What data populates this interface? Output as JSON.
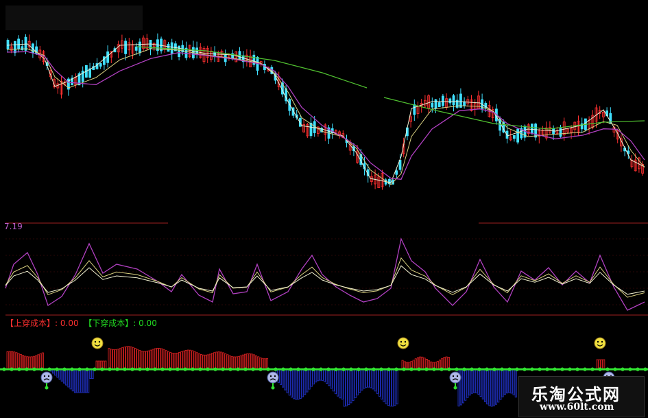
{
  "indicator": {
    "value_label": "7.19"
  },
  "legend": {
    "up_label": "【上穿成本】",
    "up_value": ": 0.00",
    "down_label": "【下穿成本】",
    "down_value": ": 0.00"
  },
  "watermark": {
    "site_name": "乐淘公式网",
    "site_url": "www.60lt.com"
  },
  "colors": {
    "background": "#000000",
    "up_candle": "#ff3030",
    "down_candle": "#40e0ff",
    "ma_white": "#f0f0d0",
    "ma_yellow": "#d8d080",
    "ma_purple": "#b040c0",
    "ma_green": "#50c030",
    "divider": "#a02020",
    "baseline": "#30e030",
    "bar_red": "#d02020",
    "bar_blue": "#2030c0",
    "signal_face": "#f0e040"
  },
  "icons": {
    "up_signal": "smiley-face-icon",
    "down_signal": "sad-face-icon"
  }
}
